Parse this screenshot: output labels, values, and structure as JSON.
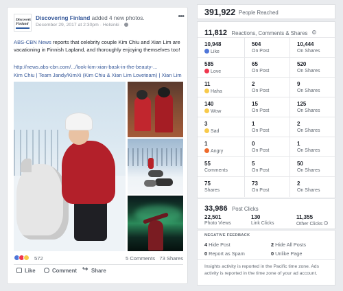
{
  "post": {
    "page_logo_text": "Discovering Finland",
    "author": "Discovering Finland",
    "action": "added 4 new photos.",
    "date": "December 29, 2017 at 2:30pm",
    "location": "Helsinki",
    "body_link_text": "ABS-CBN News",
    "body": "reports that celebrity couple Kim Chiu and Xian Lim are vacationing in Finnish Lapland, and thoroughly enjoying themselves too!",
    "url": "http://news.abs-cbn.com/.../look-kim-xian-bask-in-the-beauty-...",
    "tags": "Kim Chiu | Team Jandy/KimXi (Kim Chiu & Xian Lim Loveteam) | Xian Lim",
    "reaction_count": "572",
    "comments": "5 Comments",
    "shares": "73 Shares",
    "actions": {
      "like": "Like",
      "comment": "Comment",
      "share": "Share"
    },
    "reaction_icons": [
      "like-icon",
      "love-icon",
      "wow-icon"
    ]
  },
  "insights": {
    "people_reached": {
      "value": "391,922",
      "label": "People Reached"
    },
    "engagement": {
      "value": "11,812",
      "label": "Reactions, Comments & Shares"
    },
    "rows": [
      {
        "total": "10,948",
        "label": "Like",
        "icon": "like-icon",
        "on_post": "504",
        "on_shares": "10,444"
      },
      {
        "total": "585",
        "label": "Love",
        "icon": "love-icon",
        "on_post": "65",
        "on_shares": "520"
      },
      {
        "total": "11",
        "label": "Haha",
        "icon": "haha-icon",
        "on_post": "2",
        "on_shares": "9"
      },
      {
        "total": "140",
        "label": "Wow",
        "icon": "wow-icon",
        "on_post": "15",
        "on_shares": "125"
      },
      {
        "total": "3",
        "label": "Sad",
        "icon": "sad-icon",
        "on_post": "1",
        "on_shares": "2"
      },
      {
        "total": "1",
        "label": "Angry",
        "icon": "angry-icon",
        "on_post": "0",
        "on_shares": "1"
      },
      {
        "total": "55",
        "label": "Comments",
        "icon": "",
        "on_post": "5",
        "on_shares": "50"
      },
      {
        "total": "75",
        "label": "Shares",
        "icon": "",
        "on_post": "73",
        "on_shares": "2"
      }
    ],
    "on_post_label": "On Post",
    "on_shares_label": "On Shares",
    "post_clicks": {
      "value": "33,986",
      "label": "Post Clicks"
    },
    "clicks": [
      {
        "value": "22,501",
        "label": "Photo Views"
      },
      {
        "value": "130",
        "label": "Link Clicks"
      },
      {
        "value": "11,355",
        "label": "Other Clicks"
      }
    ],
    "negative_feedback": {
      "title": "NEGATIVE FEEDBACK",
      "items": [
        {
          "count": "4",
          "label": "Hide Post"
        },
        {
          "count": "2",
          "label": "Hide All Posts"
        },
        {
          "count": "0",
          "label": "Report as Spam"
        },
        {
          "count": "0",
          "label": "Unlike Page"
        }
      ]
    },
    "note": "Insights activity is reported in the Pacific time zone. Ads activity is reported in the time zone of your ad account."
  }
}
